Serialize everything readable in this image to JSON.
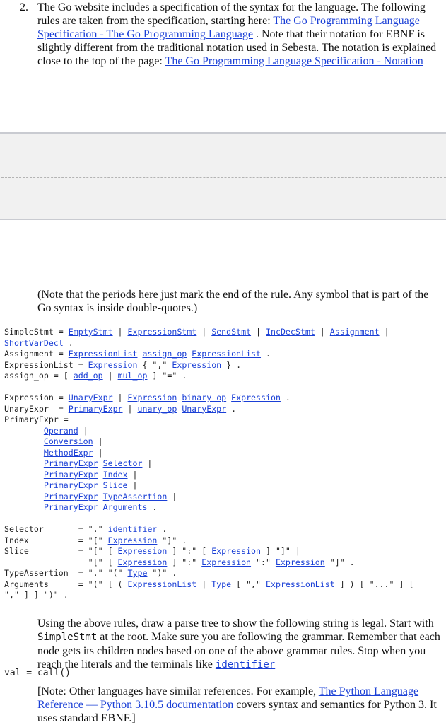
{
  "question": {
    "number": "2.",
    "text_1": "The Go website includes a specification of the syntax for the language. The following rules are taken from the specification, starting here: ",
    "link_1": "The Go Programming Language Specification - The Go Programming Language",
    "text_2": " . Note that their notation for EBNF is slightly different from the traditional notation used in Sebesta. The notation is explained close to the top of the page: ",
    "link_2": "The Go Programming Language Specification - Notation"
  },
  "note_periods": "(Note that the periods here just mark the end of the rule. Any symbol that is part of the Go syntax is inside double-quotes.)",
  "grammar": {
    "simplestmt": {
      "lhs": "SimpleStmt = ",
      "alts": [
        "EmptyStmt",
        "ExpressionStmt",
        "SendStmt",
        "IncDecStmt",
        "Assignment",
        "ShortVarDecl"
      ]
    },
    "assignment": {
      "lhs": "Assignment = ",
      "r1": "ExpressionList",
      "r2": "assign_op",
      "r3": "ExpressionList"
    },
    "expressionlist": {
      "lhs": "ExpressionList = ",
      "r1": "Expression",
      "mid": " { \",\" ",
      "r2": "Expression",
      "end": " } ."
    },
    "assign_op": {
      "lhs": "assign_op = [ ",
      "r1": "add_op",
      "r2": "mul_op",
      "end": " ] \"=\" ."
    },
    "expression": {
      "lhs": "Expression = ",
      "r1": "UnaryExpr",
      "r2": "Expression",
      "r3": "binary_op",
      "r4": "Expression"
    },
    "unaryexpr": {
      "lhs": "UnaryExpr  = ",
      "r1": "PrimaryExpr",
      "r2": "unary_op",
      "r3": "UnaryExpr"
    },
    "primaryexpr": {
      "lhs": "PrimaryExpr =",
      "alts": [
        [
          "Operand"
        ],
        [
          "Conversion"
        ],
        [
          "MethodExpr"
        ],
        [
          "PrimaryExpr",
          "Selector"
        ],
        [
          "PrimaryExpr",
          "Index"
        ],
        [
          "PrimaryExpr",
          "Slice"
        ],
        [
          "PrimaryExpr",
          "TypeAssertion"
        ],
        [
          "PrimaryExpr",
          "Arguments"
        ]
      ]
    },
    "selector": {
      "lhs": "Selector       = \".\" ",
      "r1": "identifier"
    },
    "index": {
      "lhs": "Index          = \"[\" ",
      "r1": "Expression",
      "end": " \"]\" ."
    },
    "slice": {
      "lhs": "Slice          = \"[\" [ ",
      "r1": "Expression",
      "mid1": " ] \":\" [ ",
      "r2": "Expression",
      "end1": " ] \"]\" |",
      "lhs2": "                 \"[\" [ ",
      "r3": "Expression",
      "mid2": " ] \":\" ",
      "r4": "Expression",
      "mid3": " \":\" ",
      "r5": "Expression",
      "end2": " \"]\" ."
    },
    "typeassertion": {
      "lhs": "TypeAssertion  = \".\" \"(\" ",
      "r1": "Type",
      "end": " \")\" ."
    },
    "arguments": {
      "lhs": "Arguments      = \"(\" [ ( ",
      "r1": "ExpressionList",
      "r2": "Type",
      "mid": " [ \",\" ",
      "r3": "ExpressionList",
      "end1": " ] ) [ \"...\" ] [",
      "line2": "\",\" ] ] \")\" ."
    }
  },
  "task": {
    "t1": "Using the above rules, draw a parse tree to show the following string is legal. Start with ",
    "code1": "SimpleStmt",
    "t2": " at the root. Make sure you are following the grammar. Remember that each node gets its children nodes based on one of the above grammar rules. Stop when you reach the literals and the terminals like ",
    "link": "identifier"
  },
  "input_string": "val = call()",
  "note_python": {
    "t1": "[Note: Other languages have similar references. For example, ",
    "link": "The Python Language Reference — Python 3.10.5 documentation",
    "t2": " covers syntax and semantics for Python 3. It uses standard EBNF.]"
  }
}
